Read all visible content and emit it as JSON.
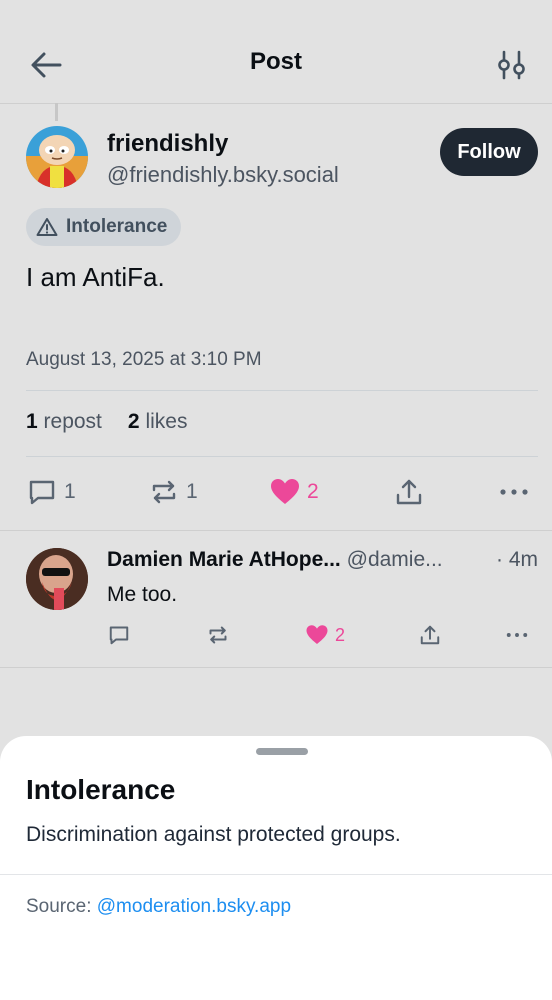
{
  "header": {
    "title": "Post"
  },
  "post": {
    "author": {
      "display_name": "friendishly",
      "handle": "@friendishly.bsky.social"
    },
    "follow_label": "Follow",
    "moderation_label": "Intolerance",
    "text": "I am AntiFa.",
    "timestamp": "August 13, 2025 at 3:10 PM",
    "stats": {
      "reposts_count": "1",
      "reposts_label": "repost",
      "likes_count": "2",
      "likes_label": "likes"
    },
    "actions": {
      "reply_count": "1",
      "repost_count": "1",
      "like_count": "2",
      "liked": true
    }
  },
  "reply": {
    "author_name": "Damien Marie AtHope...",
    "handle": "@damie...",
    "time": "· 4m",
    "text": "Me too.",
    "actions": {
      "like_count": "2",
      "liked": true
    }
  },
  "sheet": {
    "title": "Intolerance",
    "description": "Discrimination against protected groups.",
    "source_label": "Source:",
    "source_link": "@moderation.bsky.app"
  },
  "colors": {
    "like_accent": "#ec4899",
    "link": "#1d8ef0",
    "follow_bg": "#1f2833"
  },
  "icons": [
    "arrow-left-icon",
    "sliders-icon",
    "warning-icon",
    "comment-icon",
    "repost-icon",
    "heart-icon",
    "share-icon",
    "more-icon"
  ]
}
